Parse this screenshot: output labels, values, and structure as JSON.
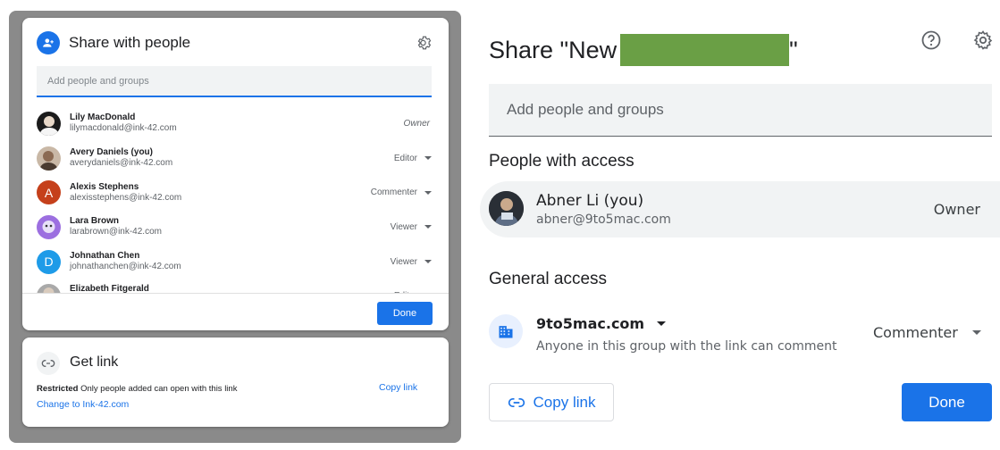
{
  "left": {
    "share_title": "Share with people",
    "add_placeholder": "Add people and groups",
    "people": [
      {
        "name": "Lily MacDonald",
        "email": "lilymacdonald@ink-42.com",
        "role": "Owner",
        "avatar_color": "#1b1b1b",
        "initial": ""
      },
      {
        "name": "Avery Daniels (you)",
        "email": "averydaniels@ink-42.com",
        "role": "Editor",
        "avatar_color": "#c9b8a6",
        "initial": ""
      },
      {
        "name": "Alexis Stephens",
        "email": "alexisstephens@ink-42.com",
        "role": "Commenter",
        "avatar_color": "#c5401b",
        "initial": "A"
      },
      {
        "name": "Lara Brown",
        "email": "larabrown@ink-42.com",
        "role": "Viewer",
        "avatar_color": "#9c6fe0",
        "initial": ""
      },
      {
        "name": "Johnathan Chen",
        "email": "johnathanchen@ink-42.com",
        "role": "Viewer",
        "avatar_color": "#1e9be8",
        "initial": "D"
      },
      {
        "name": "Elizabeth Fitgerald",
        "email": "",
        "role": "Editor",
        "avatar_color": "#a9a9a9",
        "initial": ""
      }
    ],
    "done_label": "Done",
    "get_link_title": "Get link",
    "restricted_label": "Restricted",
    "restricted_desc": "Only people added can open with this link",
    "copy_link_label": "Copy link",
    "change_link_label": "Change to Ink-42.com"
  },
  "right": {
    "title_prefix": "Share \"New",
    "title_suffix": "\"",
    "add_placeholder": "Add people and groups",
    "people_with_access_title": "People with access",
    "owner_name": "Abner Li (you)",
    "owner_email": "abner@9to5mac.com",
    "owner_role": "Owner",
    "general_access_title": "General access",
    "domain": "9to5mac.com",
    "domain_desc": "Anyone in this group with the link can comment",
    "access_role": "Commenter",
    "copy_link_label": "Copy link",
    "done_label": "Done"
  },
  "colors": {
    "accent": "#1a73e8",
    "redaction": "#6a9f45"
  }
}
